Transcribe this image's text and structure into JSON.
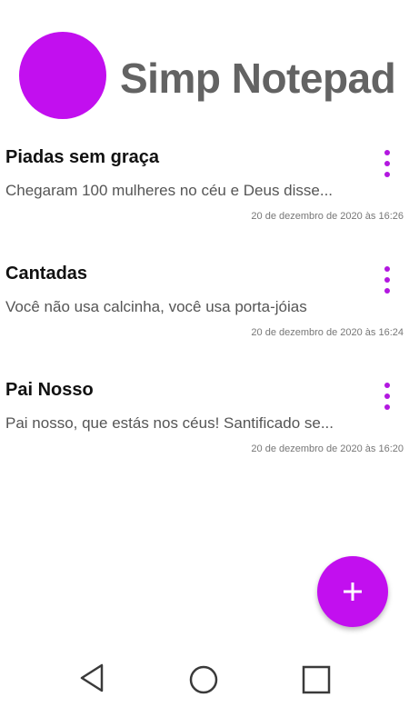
{
  "app": {
    "title": "Simp Notepad",
    "accent_color": "#c20fef"
  },
  "notes": [
    {
      "title": "Piadas sem graça",
      "preview": "Chegaram 100 mulheres no céu e Deus disse...",
      "date": "20 de dezembro de 2020 às 16:26",
      "menu_icon": "more-vert-icon"
    },
    {
      "title": "Cantadas",
      "preview": "Você não usa calcinha, você usa porta-jóias",
      "date": "20 de dezembro de 2020 às 16:24",
      "menu_icon": "more-vert-icon"
    },
    {
      "title": "Pai Nosso",
      "preview": "Pai nosso, que estás nos céus! Santificado se...",
      "date": "20 de dezembro de 2020 às 16:20",
      "menu_icon": "more-vert-icon"
    }
  ],
  "fab": {
    "icon": "plus-icon"
  },
  "navbar": {
    "back_icon": "back-triangle-icon",
    "home_icon": "home-circle-icon",
    "recents_icon": "recents-square-icon"
  }
}
